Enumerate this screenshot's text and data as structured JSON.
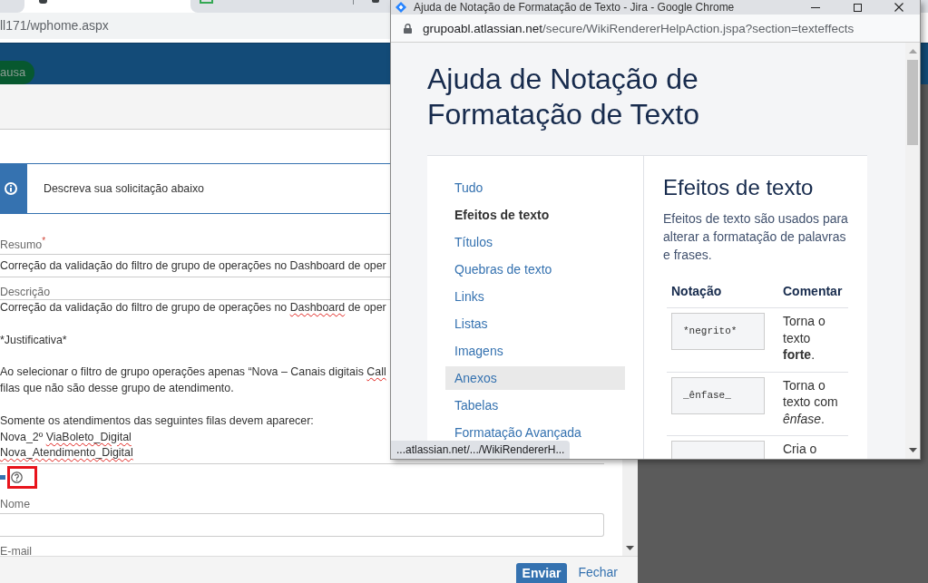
{
  "browser": {
    "tabs": [
      {
        "selected": false
      },
      {
        "selected": true
      },
      {
        "selected": false
      }
    ],
    "address": "ll171/wphome.aspx",
    "header": {
      "badge": "ausa"
    }
  },
  "modal": {
    "info_banner": "Descreva sua solicitação abaixo",
    "summary": {
      "label": "Resumo$^{*}$",
      "value": "Correção da validação do filtro de grupo de operações no Dashboard de oper"
    },
    "description": {
      "label": "Descrição",
      "paragraphs": [
        {
          "lines": [
            {
              "segments": [
                {
                  "text": "Correção da validação do filtro de grupo de operações no ",
                  "misspelled": false
                },
                {
                  "text": "Dashboard",
                  "misspelled": true
                },
                {
                  "text": " de oper",
                  "misspelled": false
                }
              ]
            }
          ]
        },
        {
          "lines": [
            {
              "segments": [
                {
                  "text": "*Justificativa*",
                  "misspelled": false
                }
              ]
            }
          ]
        },
        {
          "lines": [
            {
              "segments": [
                {
                  "text": "Ao selecionar o filtro de grupo operações apenas “Nova – Canais digitais ",
                  "misspelled": false
                },
                {
                  "text": "Call",
                  "misspelled": true
                }
              ]
            },
            {
              "segments": [
                {
                  "text": "filas que não são desse grupo de atendimento.",
                  "misspelled": false
                }
              ]
            }
          ]
        },
        {
          "lines": [
            {
              "segments": [
                {
                  "text": "Somente os atendimentos das seguintes filas devem aparecer:",
                  "misspelled": false
                }
              ]
            },
            {
              "segments": [
                {
                  "text": "Nova_2º ",
                  "misspelled": false
                },
                {
                  "text": "ViaBoleto_Digital",
                  "misspelled": true
                }
              ]
            },
            {
              "segments": [
                {
                  "text": "Nova_Atendimento_Digital",
                  "misspelled": true
                }
              ]
            }
          ]
        }
      ]
    },
    "help_icon": {
      "highlighted": true
    },
    "name": {
      "label": "Nome"
    },
    "email": {
      "label": "E-mail"
    },
    "buttons": [
      {
        "kind": "primary",
        "label": "Enviar"
      },
      {
        "kind": "link",
        "label": "Fechar"
      }
    ]
  },
  "popup": {
    "title": "Ajuda de Notação de Formatação de Texto - Jira - Google Chrome",
    "url_host": "grupoabl.atlassian.net",
    "url_path": "/secure/WikiRendererHelpAction.jspa?section=texteffects",
    "heading": "Ajuda de Notação de Formatação de Texto",
    "nav": [
      {
        "label": "Tudo",
        "selected": false,
        "hovered": false
      },
      {
        "label": "Efeitos de texto",
        "selected": true,
        "hovered": false
      },
      {
        "label": "Títulos",
        "selected": false,
        "hovered": false
      },
      {
        "label": "Quebras de texto",
        "selected": false,
        "hovered": false
      },
      {
        "label": "Links",
        "selected": false,
        "hovered": false
      },
      {
        "label": "Listas",
        "selected": false,
        "hovered": false
      },
      {
        "label": "Imagens",
        "selected": false,
        "hovered": false
      },
      {
        "label": "Anexos",
        "selected": false,
        "hovered": true
      },
      {
        "label": "Tabelas",
        "selected": false,
        "hovered": false
      },
      {
        "label": "Formatação Avançada",
        "selected": false,
        "hovered": false
      }
    ],
    "section": {
      "title": "Efeitos de texto",
      "intro": "Efeitos de texto são usados para alterar a formatação de palavras e frases.",
      "columns": [
        "Notação",
        "Comentar"
      ],
      "rows": [
        {
          "notation": "*negrito*",
          "comment": "Torna o texto **forte**."
        },
        {
          "notation": "_ênfase_",
          "comment": "Torna o texto com *ênfase*."
        },
        {
          "comment": "Cria o"
        }
      ]
    },
    "status_link": "...atlassian.net/.../WikiRendererH..."
  }
}
